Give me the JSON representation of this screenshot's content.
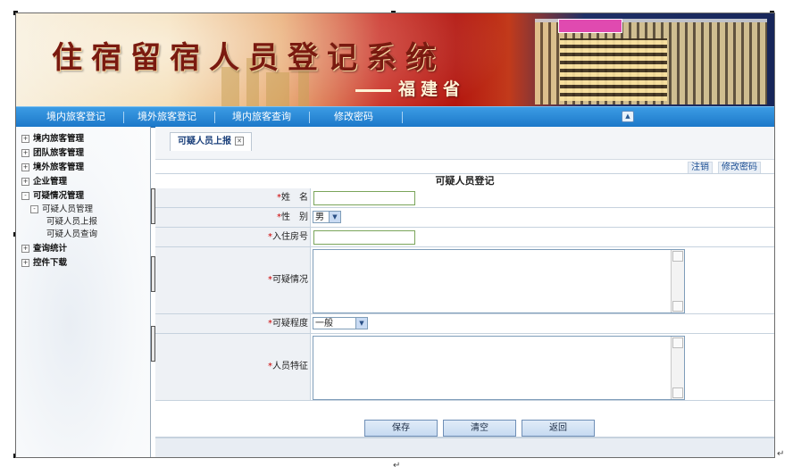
{
  "banner": {
    "title": "住宿留宿人员登记系统",
    "subtitle": "福建省"
  },
  "nav": {
    "items": [
      "境内旅客登记",
      "境外旅客登记",
      "境内旅客查询",
      "修改密码"
    ]
  },
  "sidebar": {
    "items": [
      {
        "label": "境内旅客管理",
        "state": "+"
      },
      {
        "label": "团队旅客管理",
        "state": "+"
      },
      {
        "label": "境外旅客管理",
        "state": "+"
      },
      {
        "label": "企业管理",
        "state": "+"
      },
      {
        "label": "可疑情况管理",
        "state": "-"
      },
      {
        "label": "可疑人员管理",
        "state": "-"
      },
      {
        "label": "可疑人员上报"
      },
      {
        "label": "可疑人员查询"
      },
      {
        "label": "查询统计",
        "state": "+"
      },
      {
        "label": "控件下载",
        "state": "+"
      }
    ]
  },
  "tab": {
    "label": "可疑人员上报"
  },
  "toolbar": {
    "logout": "注销",
    "change_password": "修改密码"
  },
  "form": {
    "title": "可疑人员登记",
    "name_label": "姓　名",
    "gender_label": "性　别",
    "gender_value": "男",
    "room_label": "入住房号",
    "situation_label": "可疑情况",
    "degree_label": "可疑程度",
    "degree_value": "一般",
    "features_label": "人员特征",
    "required_mark": "*"
  },
  "buttons": {
    "save": "保存",
    "clear": "清空",
    "back": "返回"
  }
}
